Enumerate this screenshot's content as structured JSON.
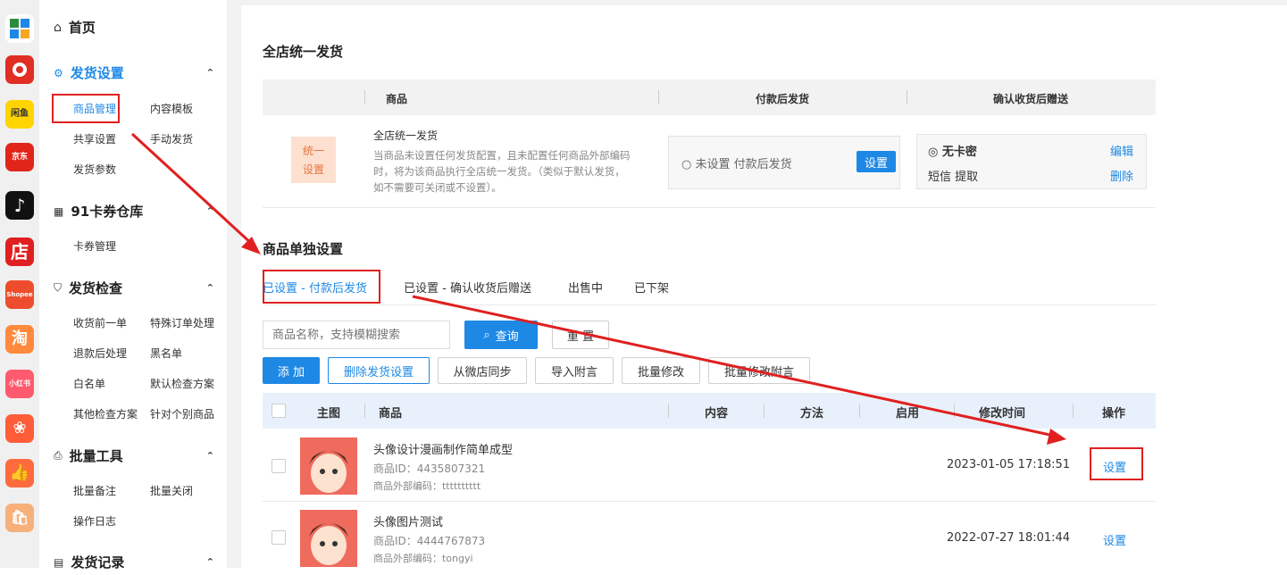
{
  "rail": {
    "apps": [
      "app-grid",
      "pdd",
      "fish",
      "jd",
      "douyin",
      "dian",
      "shopee",
      "tao",
      "xhs",
      "kuaishou",
      "like",
      "store"
    ],
    "dian_text": "店",
    "jd_text": "京东",
    "shopee_text": "Shopee",
    "tao_text": "淘",
    "xhs_text": "小红书",
    "fish_text": "闲鱼"
  },
  "sidebar": {
    "home": "首页",
    "group1": {
      "title": "发货设置",
      "items": [
        "商品管理",
        "内容模板",
        "共享设置",
        "手动发货",
        "发货参数"
      ]
    },
    "group2": {
      "title": "91卡券仓库",
      "items": [
        "卡券管理"
      ]
    },
    "group3": {
      "title": "发货检查",
      "items": [
        "收货前一单",
        "特殊订单处理",
        "退款后处理",
        "黑名单",
        "白名单",
        "默认检查方案",
        "其他检查方案",
        "针对个别商品"
      ]
    },
    "group4": {
      "title": "批量工具",
      "items": [
        "批量备注",
        "批量关闭",
        "操作日志"
      ]
    },
    "group5": {
      "title": "发货记录"
    }
  },
  "global": {
    "title": "全店统一发货",
    "headers": [
      "商品",
      "付款后发货",
      "确认收货后赠送"
    ],
    "badge1": "统一",
    "badge2": "设置",
    "desc_title": "全店统一发货",
    "desc_lines": [
      "当商品未设置任何发货配置，且未配置任何商品外部编码",
      "时，将为该商品执行全店统一发货。（类似于默认发货，",
      "如不需要可关闭或不设置）。"
    ],
    "pay_status": "未设置 付款后发货",
    "pay_btn": "设置",
    "gift_title": "无卡密",
    "gift_sub": "短信 提取",
    "edit": "编辑",
    "delete": "删除"
  },
  "single": {
    "title": "商品单独设置",
    "tabs": [
      "已设置 - 付款后发货",
      "已设置 - 确认收货后赠送",
      "出售中",
      "已下架"
    ],
    "search_placeholder": "商品名称，支持模糊搜索",
    "search_btn": "查询",
    "reset_btn": "重 置",
    "actions": [
      "添 加",
      "删除发货设置",
      "从微店同步",
      "导入附言",
      "批量修改",
      "批量修改附言"
    ],
    "columns": [
      "主图",
      "商品",
      "内容",
      "方法",
      "启用",
      "修改时间",
      "操作"
    ],
    "rows": [
      {
        "name": "头像设计漫画制作简单成型",
        "id": "商品ID：4435807321",
        "code": "商品外部编码：tttttttttt",
        "time": "2023-01-05 17:18:51",
        "op": "设置"
      },
      {
        "name": "头像图片测试",
        "id": "商品ID：4444767873",
        "code": "商品外部编码：tongyi",
        "time": "2022-07-27 18:01:44",
        "op": "设置"
      }
    ]
  },
  "colors": {
    "accent": "#1e88e5",
    "annot": "#e02020"
  }
}
